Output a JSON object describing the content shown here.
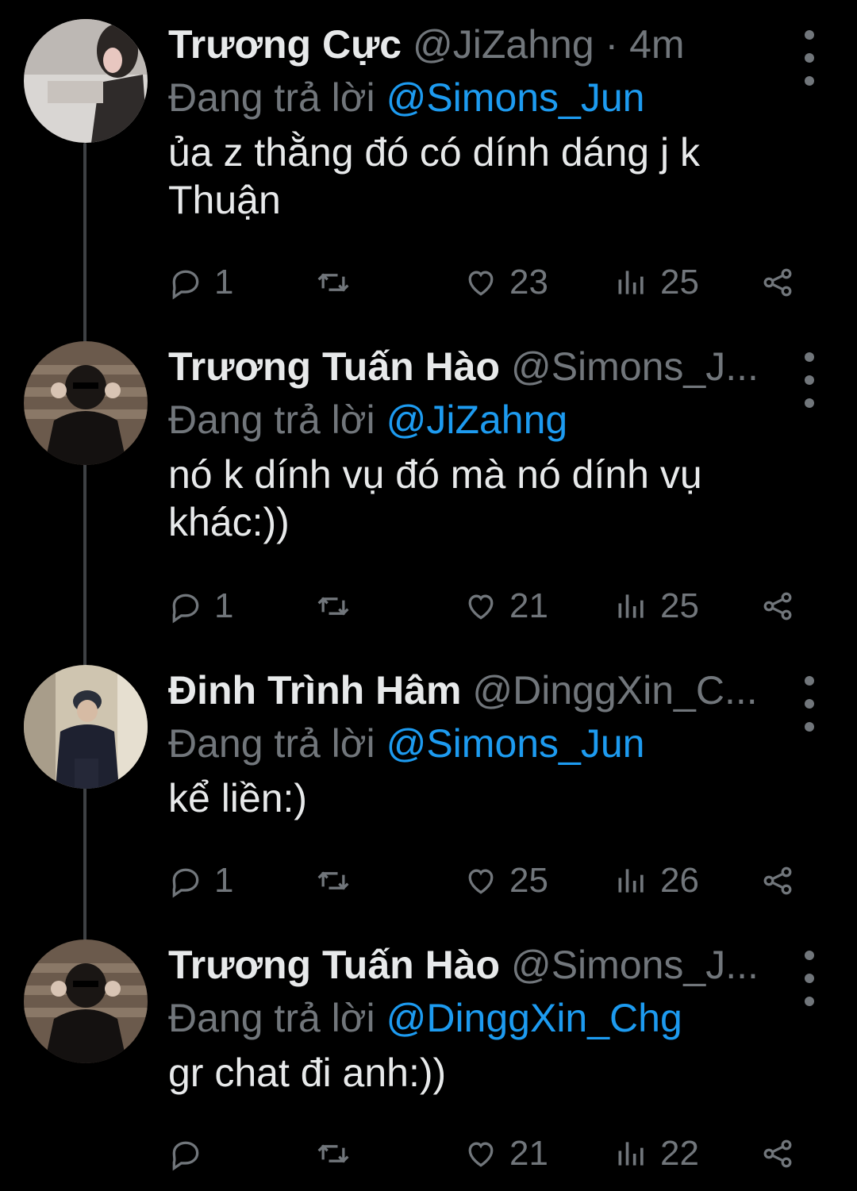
{
  "tweets": [
    {
      "name": "Trương Cực",
      "handle": "@JiZahng",
      "time": "· 4m",
      "reply_prefix": "Đang trả lời",
      "reply_to": "@Simons_Jun",
      "text_line1": "ủa z thằng đó có dính dáng j k",
      "text_line2": "Thuận",
      "replies": "1",
      "retweets": "",
      "likes": "23",
      "views": "25"
    },
    {
      "name": "Trương Tuấn Hào",
      "handle": "@Simons_J...",
      "time": "",
      "reply_prefix": "Đang trả lời",
      "reply_to": "@JiZahng",
      "text_line1": "nó k dính vụ đó mà nó dính vụ",
      "text_line2": "khác:))",
      "replies": "1",
      "retweets": "",
      "likes": "21",
      "views": "25"
    },
    {
      "name": "Đinh Trình Hâm",
      "handle": "@DinggXin_C...",
      "time": "",
      "reply_prefix": "Đang trả lời",
      "reply_to": "@Simons_Jun",
      "text_line1": "kể liền:)",
      "text_line2": "",
      "replies": "1",
      "retweets": "",
      "likes": "25",
      "views": "26"
    },
    {
      "name": "Trương Tuấn Hào",
      "handle": "@Simons_J...",
      "time": "",
      "reply_prefix": "Đang trả lời",
      "reply_to": "@DinggXin_Chg",
      "text_line1": "gr chat đi anh:))",
      "text_line2": "",
      "replies": "",
      "retweets": "",
      "likes": "21",
      "views": "22"
    }
  ],
  "icons": {
    "reply": "reply-icon",
    "retweet": "retweet-icon",
    "like": "heart-icon",
    "views": "views-icon",
    "share": "share-icon",
    "more": "more-icon"
  },
  "colors": {
    "background": "#000000",
    "text": "#e7e9ea",
    "muted": "#71767b",
    "link": "#1d9bf0"
  }
}
